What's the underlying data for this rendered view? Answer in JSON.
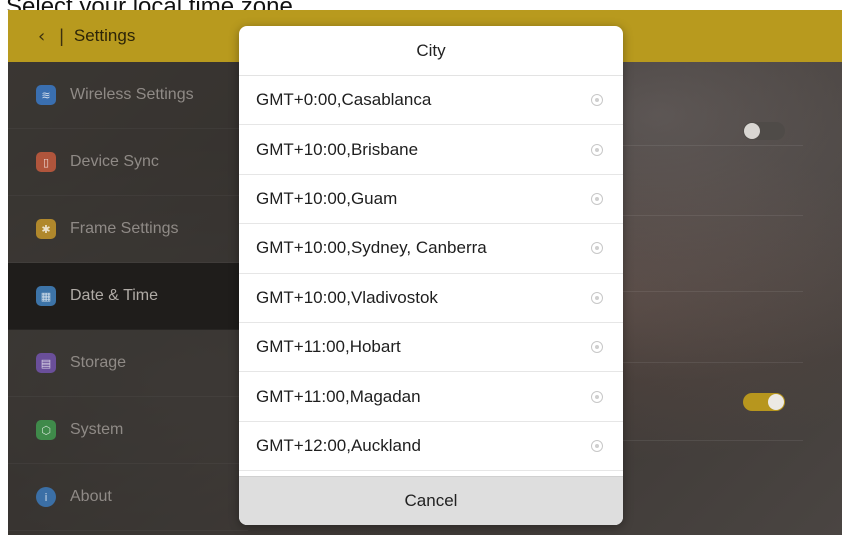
{
  "caption": "Select your local time zone.",
  "header": {
    "back_glyph": "‹",
    "divider": "|",
    "title": "Settings"
  },
  "sidebar": {
    "items": [
      {
        "label": "Wireless Settings",
        "icon": "wifi-icon",
        "color": "#3a6fb0",
        "glyph": "≋"
      },
      {
        "label": "Device Sync",
        "icon": "device-icon",
        "color": "#b0553c",
        "glyph": "▯"
      },
      {
        "label": "Frame Settings",
        "icon": "frame-settings-icon",
        "color": "#b0882c",
        "glyph": "✱"
      },
      {
        "label": "Date & Time",
        "icon": "calendar-icon",
        "color": "#3d74a8",
        "glyph": "▦"
      },
      {
        "label": "Storage",
        "icon": "storage-icon",
        "color": "#6a4f9a",
        "glyph": "▤"
      },
      {
        "label": "System",
        "icon": "system-icon",
        "color": "#3f8a4a",
        "glyph": "⬡"
      },
      {
        "label": "About",
        "icon": "info-icon",
        "color": "#3b6fa6",
        "glyph": "i"
      }
    ]
  },
  "dialog": {
    "title": "City",
    "cities": [
      "GMT+0:00,Casablanca",
      "GMT+10:00,Brisbane",
      "GMT+10:00,Guam",
      "GMT+10:00,Sydney, Canberra",
      "GMT+10:00,Vladivostok",
      "GMT+11:00,Hobart",
      "GMT+11:00,Magadan",
      "GMT+12:00,Auckland"
    ],
    "cancel_label": "Cancel"
  },
  "colors": {
    "accent": "#b89a1e",
    "dialog_bg": "#ffffff",
    "cancel_bg": "#dedede"
  }
}
